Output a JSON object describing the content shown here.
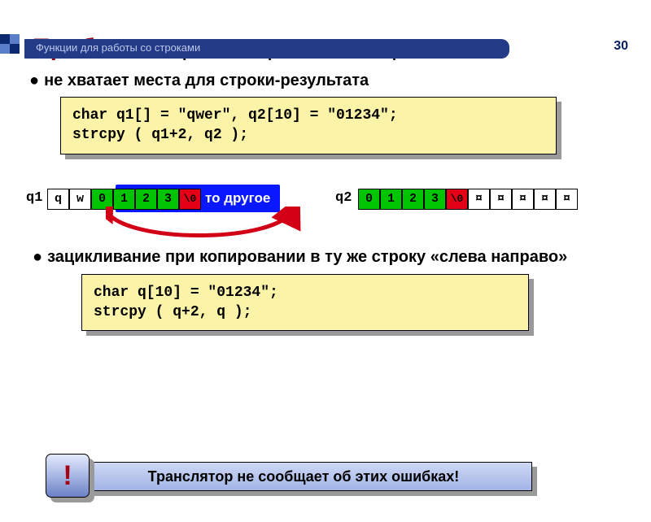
{
  "header": {
    "topic": "Функции для работы со строками",
    "page": "30"
  },
  "title_red": "Проблемы",
  "title_rest": " при копировании строк",
  "bullet1": "не хватает места для строки-результата",
  "code1": "char q1[] = \"qwer\", q2[10] = \"01234\";\nstrcpy ( q1+2, q2 );",
  "strip": {
    "q1_label": "q1",
    "q2_label": "q2",
    "other": "то другое",
    "q1_cells": [
      "q",
      "w",
      "0",
      "1",
      "2",
      "3",
      "\\0"
    ],
    "q2_cells": [
      "0",
      "1",
      "2",
      "3",
      "\\0",
      "¤",
      "¤",
      "¤",
      "¤",
      "¤"
    ]
  },
  "bullet2": "зацикливание при копировании в ту же строку «слева направо»",
  "code2": "char q[10] = \"01234\";\nstrcpy ( q+2, q );",
  "warn": {
    "mark": "!",
    "text": "Транслятор не сообщает об этих ошибках!"
  }
}
